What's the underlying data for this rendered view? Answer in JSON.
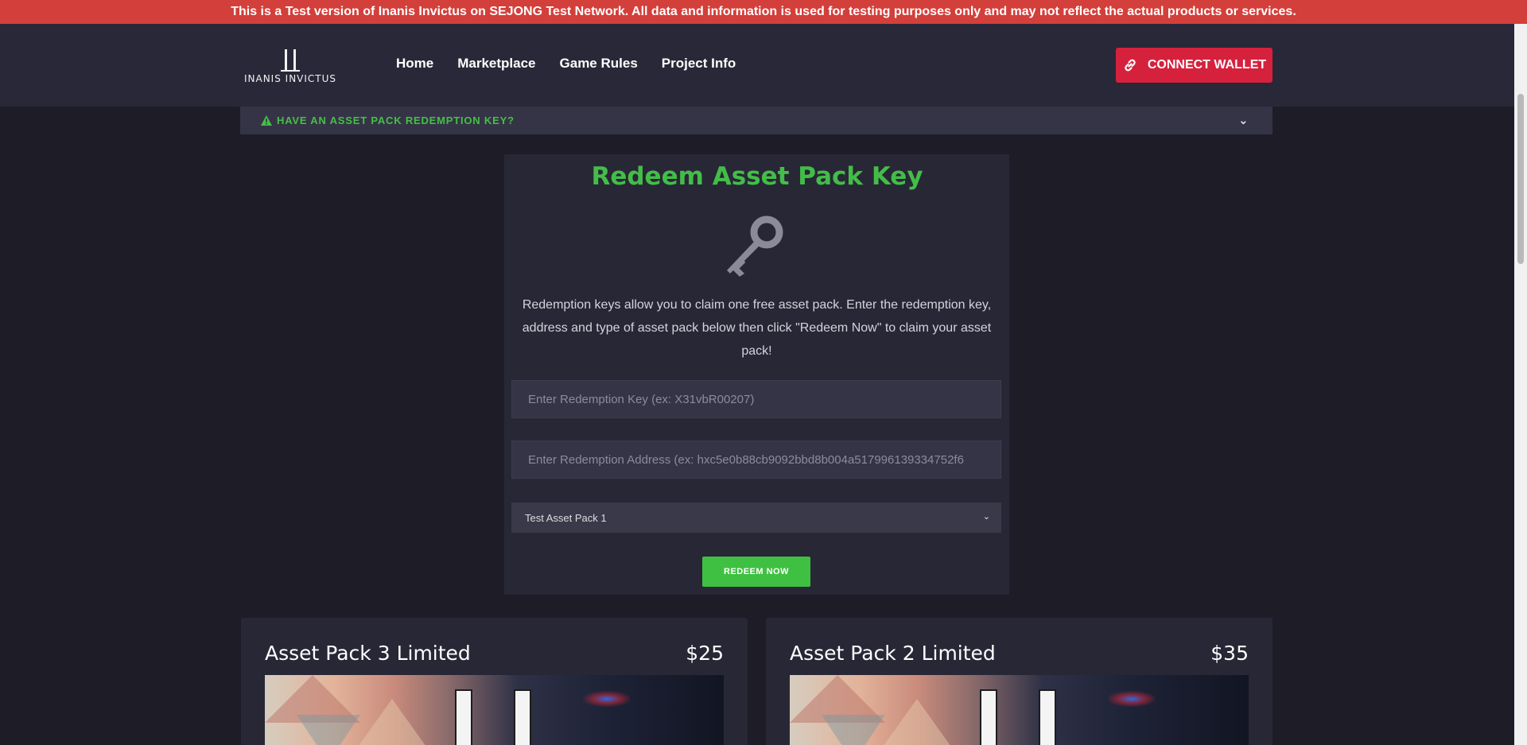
{
  "banner": {
    "text": "This is a Test version of Inanis Invictus on SEJONG Test Network. All data and information is used for testing purposes only and may not reflect the actual products or services."
  },
  "header": {
    "logo_text": "INANIS INVICTUS",
    "nav": [
      "Home",
      "Marketplace",
      "Game Rules",
      "Project Info"
    ],
    "connect_label": "CONNECT WALLET",
    "connect_icon": "link-icon"
  },
  "accordion": {
    "label": "HAVE AN ASSET PACK REDEMPTION KEY?",
    "icon": "warning-icon"
  },
  "redeem": {
    "title": "Redeem Asset Pack Key",
    "icon": "key-icon",
    "description": "Redemption keys allow you to claim one free asset pack. Enter the redemption key, address and type of asset pack below then click \"Redeem Now\" to claim your asset pack!",
    "key_placeholder": "Enter Redemption Key (ex: X31vbR00207)",
    "address_placeholder": "Enter Redemption Address (ex: hxc5e0b88cb9092bbd8b004a517996139334752f6",
    "selected_pack": "Test Asset Pack 1",
    "button_label": "REDEEM NOW"
  },
  "packs": [
    {
      "title": "Asset Pack 3 Limited",
      "price": "$25"
    },
    {
      "title": "Asset Pack 2 Limited",
      "price": "$35"
    }
  ],
  "colors": {
    "banner": "#d33f3a",
    "accent_green": "#43bd48",
    "connect_red": "#d6213d",
    "background": "#1d1c27"
  }
}
